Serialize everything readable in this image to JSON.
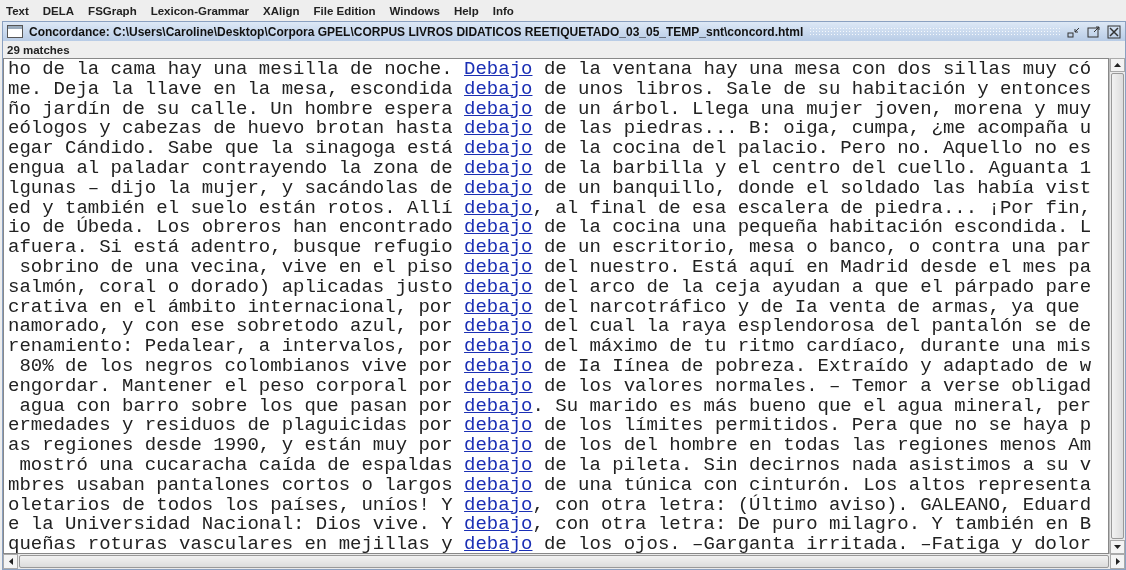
{
  "menu": [
    "Text",
    "DELA",
    "FSGraph",
    "Lexicon-Grammar",
    "XAlign",
    "File Edition",
    "Windows",
    "Help",
    "Info"
  ],
  "window": {
    "title": "Concordance: C:\\Users\\Caroline\\Desktop\\Corpora GPEL\\CORPUS LIVROS DIDATICOS REETIQUETADO_03_05_TEMP_snt\\concord.html"
  },
  "match_count": "29 matches",
  "rows": [
    {
      "left": "ho de la cama hay una mesilla de noche.",
      "match": "Debajo",
      "right": " de la ventana hay una mesa con dos sillas muy có"
    },
    {
      "left": "me. Deja la llave en la mesa, escondida",
      "match": "debajo",
      "right": " de unos libros. Sale de su habitación y entonces"
    },
    {
      "left": "ño jardín de su calle. Un hombre espera",
      "match": "debajo",
      "right": " de un árbol. Llega una mujer joven, morena y muy"
    },
    {
      "left": "eólogos y cabezas de huevo brotan hasta",
      "match": "debajo",
      "right": " de las piedras... B: oiga, cumpa, ¿me acompaña u"
    },
    {
      "left": "egar Cándido. Sabe que la sinagoga está",
      "match": "debajo",
      "right": " de la cocina del palacio. Pero no. Aquello no es"
    },
    {
      "left": "engua al paladar contrayendo la zona de",
      "match": "debajo",
      "right": " de la barbilla y el centro del cuello. Aguanta 1"
    },
    {
      "left": "lgunas – dijo la mujer, y sacándolas de",
      "match": "debajo",
      "right": " de un banquillo, donde el soldado las había vist"
    },
    {
      "left": "ed y también el suelo están rotos. Allí",
      "match": "debajo",
      "right": ", al final de esa escalera de piedra... ¡Por fin,"
    },
    {
      "left": "io de Úbeda. Los obreros han encontrado",
      "match": "debajo",
      "right": " de la cocina una pequeña habitación escondida. L"
    },
    {
      "left": "afuera. Si está adentro, busque refugio",
      "match": "debajo",
      "right": " de un escritorio, mesa o banco, o contra una par"
    },
    {
      "left": "sobrino de una vecina, vive en el piso",
      "match": "debajo",
      "right": " del nuestro. Está aquí en Madrid desde el mes pa"
    },
    {
      "left": "salmón, coral o dorado) aplicadas justo",
      "match": "debajo",
      "right": " del arco de la ceja ayudan a que el párpado pare"
    },
    {
      "left": "crativa en el ámbito internacional, por",
      "match": "debajo",
      "right": " del narcotráfico y de Ia venta de armas, ya que"
    },
    {
      "left": "namorado, y con ese sobretodo azul, por",
      "match": "debajo",
      "right": " del cual la raya esplendorosa del pantalón se de"
    },
    {
      "left": "renamiento: Pedalear, a intervalos, por",
      "match": "debajo",
      "right": " del máximo de tu ritmo cardíaco, durante una mis"
    },
    {
      "left": "80% de los negros colombianos vive por",
      "match": "debajo",
      "right": " de Ia Iínea de pobreza. Extraído y adaptado de w"
    },
    {
      "left": "engordar. Mantener el peso corporal por",
      "match": "debajo",
      "right": " de los valores normales. – Temor a verse obligad"
    },
    {
      "left": "agua con barro sobre los que pasan por",
      "match": "debajo",
      "right": ". Su marido es más bueno que el agua mineral, per"
    },
    {
      "left": "ermedades y residuos de plaguicidas por",
      "match": "debajo",
      "right": " de los límites permitidos. Pera que no se haya p"
    },
    {
      "left": "as regiones desde 1990, y están muy por",
      "match": "debajo",
      "right": " de los del hombre en todas las regiones menos Am"
    },
    {
      "left": "mostró una cucaracha caída de espaldas",
      "match": "debajo",
      "right": " de la pileta. Sin decirnos nada asistimos a su v"
    },
    {
      "left": "mbres usaban pantalones cortos o largos",
      "match": "debajo",
      "right": " de una túnica con cinturón. Los altos representa"
    },
    {
      "left": "oletarios de todos los países, uníos! Y",
      "match": "debajo",
      "right": ", con otra letra: (Último aviso). GALEANO, Eduard"
    },
    {
      "left": "e la Universidad Nacional: Dios vive. Y",
      "match": "debajo",
      "right": ", con otra letra: De puro milagro. Y también en B"
    },
    {
      "left": "queñas roturas vasculares en mejillas y",
      "match": "debajo",
      "right": " de los ojos. –Garganta irritada. –Fatiga y dolor"
    }
  ]
}
